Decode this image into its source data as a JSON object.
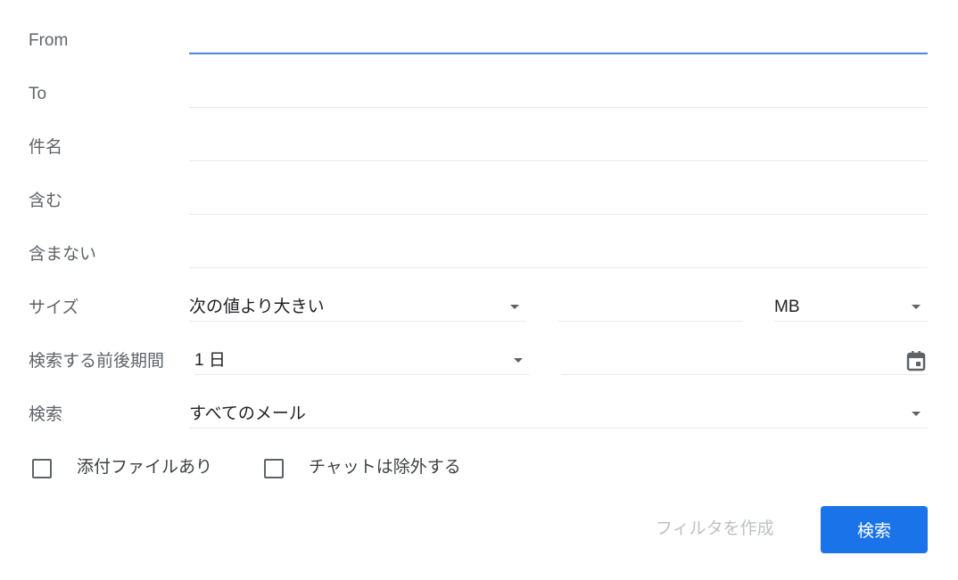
{
  "fields": {
    "from": {
      "label": "From",
      "value": ""
    },
    "to": {
      "label": "To",
      "value": ""
    },
    "subject": {
      "label": "件名",
      "value": ""
    },
    "has_words": {
      "label": "含む",
      "value": ""
    },
    "doesnt_have": {
      "label": "含まない",
      "value": ""
    }
  },
  "size": {
    "label": "サイズ",
    "operator": "次の値より大きい",
    "value": "",
    "unit": "MB"
  },
  "date_within": {
    "label": "検索する前後期間",
    "range": "1 日",
    "date": "",
    "icon": "calendar-icon"
  },
  "search_in": {
    "label": "検索",
    "value": "すべてのメール"
  },
  "checkboxes": {
    "has_attachment": {
      "label": "添付ファイルあり",
      "checked": false
    },
    "exclude_chats": {
      "label": "チャットは除外する",
      "checked": false
    }
  },
  "actions": {
    "create_filter": "フィルタを作成",
    "search": "検索"
  },
  "colors": {
    "accent": "#1a73e8",
    "focus": "#4a86e8"
  }
}
